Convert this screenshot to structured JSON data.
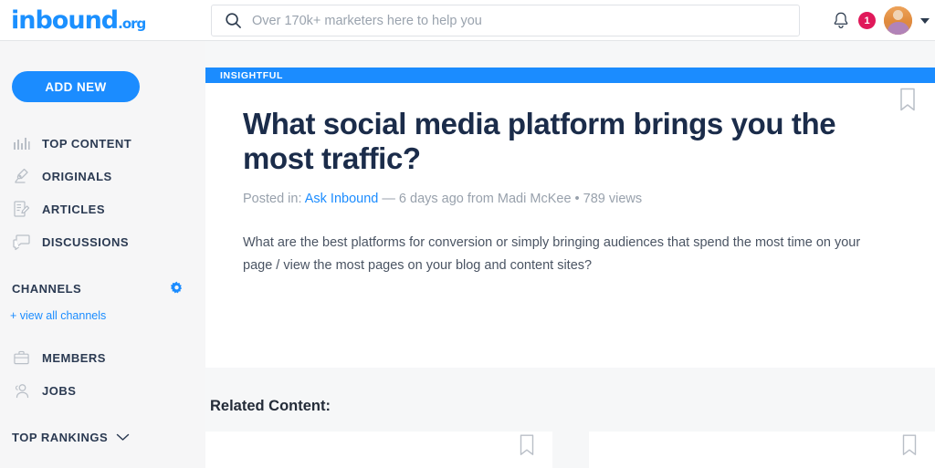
{
  "header": {
    "logo_text": "inbound",
    "logo_suffix": ".org",
    "search": {
      "placeholder": "Over 170k+ marketers here to help you",
      "value": "",
      "icon": "search-icon"
    },
    "notifications": {
      "icon": "bell-icon",
      "count": "1"
    },
    "account": {
      "avatar": "user-avatar",
      "chevron": "chevron-down-icon"
    }
  },
  "sidebar": {
    "add_new_label": "ADD NEW",
    "nav": [
      {
        "label": "TOP CONTENT",
        "icon": "bar-chart-icon"
      },
      {
        "label": "ORIGINALS",
        "icon": "microscope-icon"
      },
      {
        "label": "ARTICLES",
        "icon": "article-edit-icon"
      },
      {
        "label": "DISCUSSIONS",
        "icon": "chat-bubbles-icon"
      }
    ],
    "channels": {
      "title": "CHANNELS",
      "settings_icon": "gear-icon",
      "view_all_label": "+ view all channels"
    },
    "nav2": [
      {
        "label": "MEMBERS",
        "icon": "briefcase-icon"
      },
      {
        "label": "JOBS",
        "icon": "person-icon"
      }
    ],
    "top_rankings": {
      "title": "TOP RANKINGS",
      "icon": "chevron-down-icon"
    }
  },
  "post": {
    "banner_label": "INSIGHTFUL",
    "bookmark_icon": "bookmark-icon",
    "title": "What social media platform brings you the most traffic?",
    "meta": {
      "posted_in_label": "Posted in:",
      "channel": "Ask Inbound",
      "details": "— 6 days ago from Madi McKee  •  789 views"
    },
    "body": "What are the best platforms for conversion or simply bringing audiences that spend the most time on your page / view the most pages on your blog and content sites?"
  },
  "related": {
    "heading": "Related Content:",
    "cards": [
      {
        "bookmark_icon": "bookmark-icon"
      },
      {
        "bookmark_icon": "bookmark-icon"
      }
    ]
  },
  "colors": {
    "brand_blue": "#1b8cff",
    "badge_red": "#e0195a",
    "sidebar_bg": "#f6f6f7",
    "page_bg": "#f6f7f8",
    "title_navy": "#1b2c4a"
  }
}
